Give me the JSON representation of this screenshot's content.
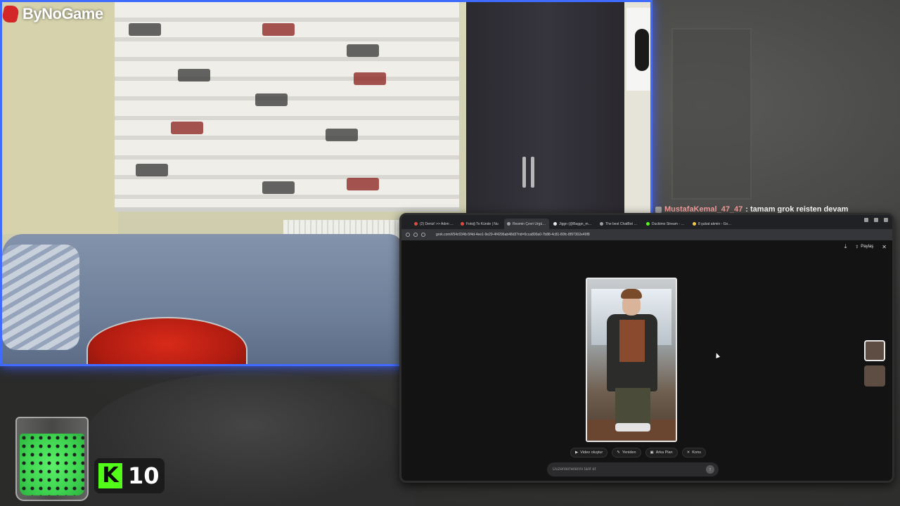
{
  "overlay": {
    "brand_logo_text": "ByNoGame",
    "kick_count": "10",
    "kick_logo_letter": "K"
  },
  "chat": {
    "username": "MustafaKemal_47_47",
    "message": ": tamam grok reisten devam"
  },
  "browser": {
    "tabs": [
      {
        "label": "(2) Deniz! >> Adım Adım",
        "color": "#e34a3c",
        "active": false
      },
      {
        "label": "Fotoğ To Künde | Nu",
        "color": "#e34a3c",
        "active": false
      },
      {
        "label": "Resmin Çevri Ürgüleme",
        "color": "#9aa0a6",
        "active": true
      },
      {
        "label": "Jiggn (@Baggn_mert) / X",
        "color": "#e8e8e8",
        "active": false
      },
      {
        "label": "The best ChatBot and W",
        "color": "#9aa0a6",
        "active": false
      },
      {
        "label": "Duckimo Stream - Watch",
        "color": "#53fc18",
        "active": false
      },
      {
        "label": "8 şubat akmin - Google",
        "color": "#f2c94c",
        "active": false
      }
    ],
    "url": "grok.com/i/54c034b-5f4d-4ee1-9e29-4f4296ab48d3?rid=0cca800a0-7b88-4c81-80fc-8f97302e49f8",
    "share_label": "Paylaş",
    "actions": [
      {
        "icon": "▶",
        "label": "Video oluştur"
      },
      {
        "icon": "✎",
        "label": "Yeniden"
      },
      {
        "icon": "▣",
        "label": "Arka Plan"
      },
      {
        "icon": "✕",
        "label": "Konu"
      }
    ],
    "prompt_placeholder": "Düzenlemelerini tarif et"
  }
}
